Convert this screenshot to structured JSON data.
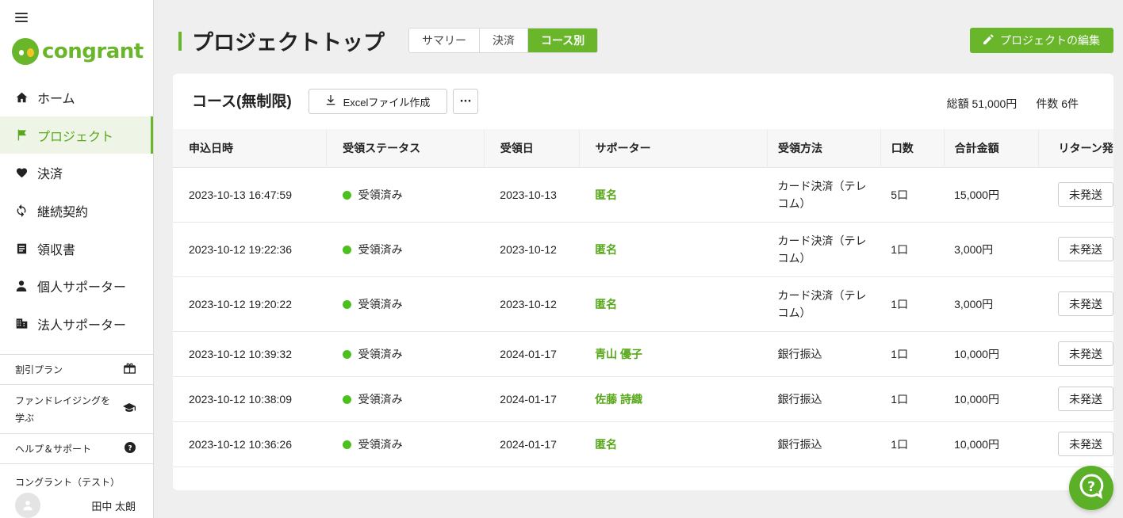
{
  "brand": {
    "name": "congrant",
    "color": "#6ab62a"
  },
  "nav": [
    {
      "label": "ホーム",
      "icon": "home-icon"
    },
    {
      "label": "プロジェクト",
      "icon": "flag-icon",
      "active": true
    },
    {
      "label": "決済",
      "icon": "heart-icon"
    },
    {
      "label": "継続契約",
      "icon": "sync-icon"
    },
    {
      "label": "領収書",
      "icon": "receipt-icon"
    },
    {
      "label": "個人サポーター",
      "icon": "person-icon"
    },
    {
      "label": "法人サポーター",
      "icon": "building-icon"
    }
  ],
  "sidebar_sub": {
    "discount": "割引プラン",
    "learn_line1": "ファンドレイジングを",
    "learn_line2": "学ぶ",
    "help": "ヘルプ＆サポート",
    "org": "コングラント（テスト）",
    "user": "田中 太朗"
  },
  "header": {
    "title": "プロジェクトトップ",
    "tabs": [
      "サマリー",
      "決済",
      "コース別"
    ],
    "active_tab": "コース別",
    "edit_button": "プロジェクトの編集"
  },
  "card": {
    "title": "コース(無制限)",
    "excel_button": "Excelファイル作成",
    "more_button": "···",
    "total": "総額 51,000円",
    "count": "件数 6件"
  },
  "table": {
    "columns": [
      "申込日時",
      "受領ステータス",
      "受領日",
      "サポーター",
      "受領方法",
      "口数",
      "合計金額",
      "リターン発"
    ],
    "rows": [
      {
        "date": "2023-10-13 16:47:59",
        "status": "受領済み",
        "received": "2023-10-13",
        "supporter": "匿名",
        "method1": "カード決済（テレ",
        "method2": "コム）",
        "units": "5口",
        "amount": "15,000円",
        "return": "未発送"
      },
      {
        "date": "2023-10-12 19:22:36",
        "status": "受領済み",
        "received": "2023-10-12",
        "supporter": "匿名",
        "method1": "カード決済（テレ",
        "method2": "コム）",
        "units": "1口",
        "amount": "3,000円",
        "return": "未発送"
      },
      {
        "date": "2023-10-12 19:20:22",
        "status": "受領済み",
        "received": "2023-10-12",
        "supporter": "匿名",
        "method1": "カード決済（テレ",
        "method2": "コム）",
        "units": "1口",
        "amount": "3,000円",
        "return": "未発送"
      },
      {
        "date": "2023-10-12 10:39:32",
        "status": "受領済み",
        "received": "2024-01-17",
        "supporter": "青山 優子",
        "method1": "銀行振込",
        "method2": "",
        "units": "1口",
        "amount": "10,000円",
        "return": "未発送"
      },
      {
        "date": "2023-10-12 10:38:09",
        "status": "受領済み",
        "received": "2024-01-17",
        "supporter": "佐藤 詩織",
        "method1": "銀行振込",
        "method2": "",
        "units": "1口",
        "amount": "10,000円",
        "return": "未発送"
      },
      {
        "date": "2023-10-12 10:36:26",
        "status": "受領済み",
        "received": "2024-01-17",
        "supporter": "匿名",
        "method1": "銀行振込",
        "method2": "",
        "units": "1口",
        "amount": "10,000円",
        "return": "未発送"
      }
    ]
  }
}
